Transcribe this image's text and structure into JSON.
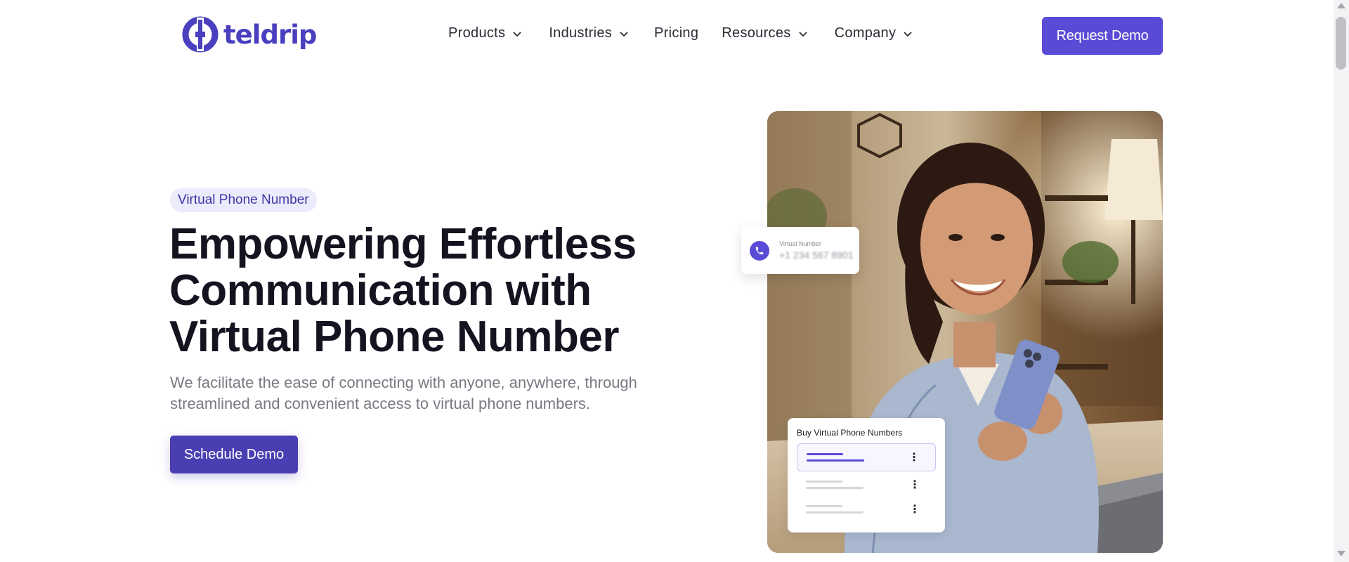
{
  "header": {
    "logo_text": "teldrip",
    "nav": [
      {
        "label": "Products",
        "has_dropdown": true
      },
      {
        "label": "Industries",
        "has_dropdown": true
      },
      {
        "label": "Pricing",
        "has_dropdown": false
      },
      {
        "label": "Resources",
        "has_dropdown": true
      },
      {
        "label": "Company",
        "has_dropdown": true
      }
    ],
    "cta_label": "Request Demo"
  },
  "hero": {
    "badge": "Virtual Phone Number",
    "title_lines": [
      "Empowering Effortless",
      "Communication with",
      "Virtual Phone Number"
    ],
    "subtitle_lines": [
      "We facilitate the ease of connecting with anyone, anywhere, through",
      "streamlined and convenient access to virtual phone numbers."
    ],
    "cta_label": "Schedule Demo"
  },
  "overlay_cards": {
    "virtual_number_label": "Virtual Number",
    "virtual_number_value": "+1 234 567 8901",
    "buy_title": "Buy Virtual Phone Numbers"
  },
  "colors": {
    "brand": "#5a4bd6",
    "brand_dark": "#4a3fb2",
    "badge_bg": "#ecebfb",
    "title": "#14131f",
    "subtitle": "#7a7983"
  },
  "icons": {
    "logo": "teldrip-logo-icon",
    "dropdown": "chevron-down-icon",
    "phone": "phone-icon",
    "more": "more-vertical-icon"
  }
}
